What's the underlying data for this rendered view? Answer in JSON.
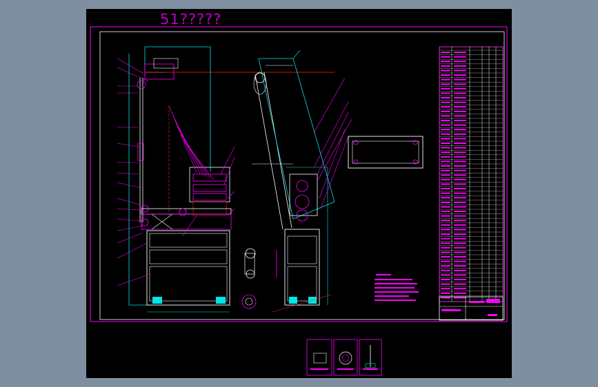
{
  "drawing": {
    "title": "51?????",
    "colors": {
      "background": "#000000",
      "frame": "#ff00ff",
      "cyan": "#00e5e5",
      "red": "#ff2020",
      "white": "#ffffff",
      "table": "#ff40ff"
    }
  }
}
